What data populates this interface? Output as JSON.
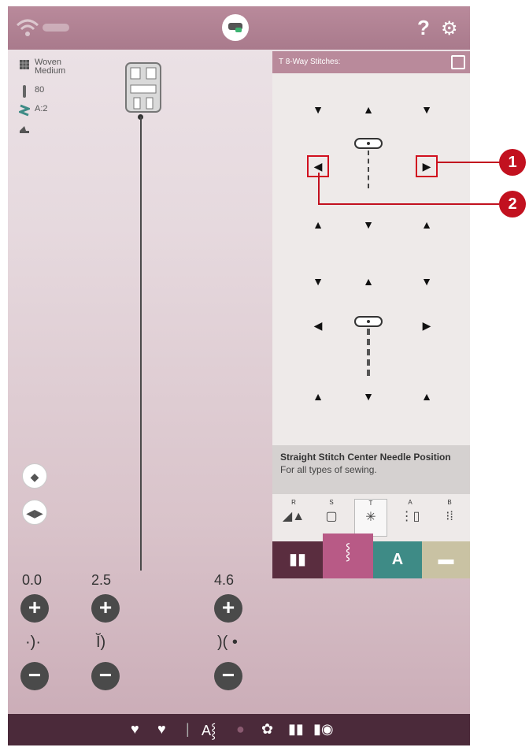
{
  "fabric": {
    "type": "Woven",
    "weight": "Medium"
  },
  "needle": {
    "size": "80"
  },
  "stabilizer": {
    "label": "A:2"
  },
  "panel": {
    "title": "T 8-Way Stitches:"
  },
  "stitch": {
    "title": "Straight Stitch Center Needle Position",
    "description": "For all types of sewing."
  },
  "categories": [
    {
      "letter": "R",
      "icon": "foot-icon"
    },
    {
      "letter": "S",
      "icon": "frame-icon"
    },
    {
      "letter": "T",
      "icon": "eight-way-icon"
    },
    {
      "letter": "A",
      "icon": "utility-stitch-icon"
    },
    {
      "letter": "B",
      "icon": "buttonhole-icon"
    }
  ],
  "bottom_tabs": [
    {
      "name": "book",
      "color": "#5a2d3f"
    },
    {
      "name": "stitch",
      "color": "#b85a86"
    },
    {
      "name": "alphabet",
      "color": "#3e8b86",
      "label": "A"
    },
    {
      "name": "folder",
      "color": "#c9c2a3"
    }
  ],
  "controls": {
    "width": {
      "value": "0.0"
    },
    "length": {
      "value": "2.5"
    },
    "tension": {
      "value": "4.6"
    }
  },
  "callouts": [
    "1",
    "2"
  ],
  "colors": {
    "accent": "#b98a9b",
    "callout": "#c2111f",
    "dark": "#4b2a3a"
  }
}
